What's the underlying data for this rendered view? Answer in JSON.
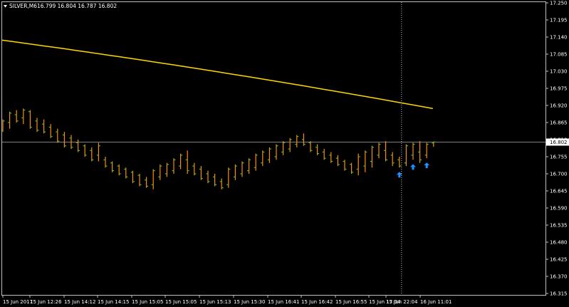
{
  "header": {
    "menu_icon": "triangle-down-icon",
    "title": "SILVER,M6",
    "ohlc": "16.799 16.804 16.787 16.802"
  },
  "colors": {
    "background": "#000000",
    "axis": "#c0c0c0",
    "bar_up": "#32cd32",
    "bar_down": "#ff8c00",
    "moving_average": "#ffd700",
    "bid_line": "#808080",
    "crosshair": "#c0c0c0",
    "arrow": "#1e90ff",
    "price_box": "#ffffff"
  },
  "price_axis": {
    "labels": [
      "17.250",
      "17.195",
      "17.140",
      "17.085",
      "17.030",
      "16.975",
      "16.920",
      "16.865",
      "16.810",
      "16.755",
      "16.700",
      "16.645",
      "16.590",
      "16.535",
      "16.480",
      "16.425",
      "16.370",
      "16.315"
    ],
    "current_price": "16.802"
  },
  "time_axis": {
    "labels": [
      "15 Jun 2017",
      "15 Jun 12:26",
      "15 Jun 14:12",
      "15 Jun 14:15",
      "15 Jun 15:05",
      "15 Jun 15:05",
      "15 Jun 15:13",
      "15 Jun 15:30",
      "15 Jun 16:41",
      "15 Jun 16:42",
      "15 Jun 16:55",
      "15 Jun 17:04",
      "15 Jun 22:04",
      "16 Jun 11:01"
    ]
  },
  "chart_data": {
    "type": "ohlc_bar",
    "symbol": "SILVER",
    "timeframe": "M6",
    "ylim": [
      16.31,
      17.25
    ],
    "bars": [
      {
        "o": 16.84,
        "h": 16.875,
        "l": 16.835,
        "c": 16.87
      },
      {
        "o": 16.865,
        "h": 16.9,
        "l": 16.845,
        "c": 16.895
      },
      {
        "o": 16.89,
        "h": 16.905,
        "l": 16.865,
        "c": 16.87
      },
      {
        "o": 16.88,
        "h": 16.91,
        "l": 16.86,
        "c": 16.905
      },
      {
        "o": 16.9,
        "h": 16.905,
        "l": 16.845,
        "c": 16.85
      },
      {
        "o": 16.87,
        "h": 16.88,
        "l": 16.835,
        "c": 16.84
      },
      {
        "o": 16.86,
        "h": 16.875,
        "l": 16.83,
        "c": 16.835
      },
      {
        "o": 16.85,
        "h": 16.86,
        "l": 16.815,
        "c": 16.82
      },
      {
        "o": 16.835,
        "h": 16.845,
        "l": 16.8,
        "c": 16.805
      },
      {
        "o": 16.825,
        "h": 16.835,
        "l": 16.785,
        "c": 16.79
      },
      {
        "o": 16.815,
        "h": 16.825,
        "l": 16.78,
        "c": 16.785
      },
      {
        "o": 16.8,
        "h": 16.81,
        "l": 16.77,
        "c": 16.775
      },
      {
        "o": 16.79,
        "h": 16.795,
        "l": 16.755,
        "c": 16.76
      },
      {
        "o": 16.775,
        "h": 16.785,
        "l": 16.74,
        "c": 16.745
      },
      {
        "o": 16.76,
        "h": 16.8,
        "l": 16.74,
        "c": 16.79
      },
      {
        "o": 16.745,
        "h": 16.755,
        "l": 16.72,
        "c": 16.725
      },
      {
        "o": 16.735,
        "h": 16.74,
        "l": 16.705,
        "c": 16.71
      },
      {
        "o": 16.725,
        "h": 16.73,
        "l": 16.695,
        "c": 16.7
      },
      {
        "o": 16.715,
        "h": 16.72,
        "l": 16.685,
        "c": 16.69
      },
      {
        "o": 16.705,
        "h": 16.71,
        "l": 16.67,
        "c": 16.675
      },
      {
        "o": 16.695,
        "h": 16.7,
        "l": 16.66,
        "c": 16.665
      },
      {
        "o": 16.68,
        "h": 16.69,
        "l": 16.655,
        "c": 16.66
      },
      {
        "o": 16.665,
        "h": 16.715,
        "l": 16.65,
        "c": 16.71
      },
      {
        "o": 16.69,
        "h": 16.73,
        "l": 16.68,
        "c": 16.725
      },
      {
        "o": 16.7,
        "h": 16.735,
        "l": 16.69,
        "c": 16.73
      },
      {
        "o": 16.71,
        "h": 16.75,
        "l": 16.7,
        "c": 16.745
      },
      {
        "o": 16.725,
        "h": 16.765,
        "l": 16.715,
        "c": 16.76
      },
      {
        "o": 16.745,
        "h": 16.775,
        "l": 16.7,
        "c": 16.71
      },
      {
        "o": 16.725,
        "h": 16.735,
        "l": 16.695,
        "c": 16.7
      },
      {
        "o": 16.715,
        "h": 16.725,
        "l": 16.68,
        "c": 16.685
      },
      {
        "o": 16.7,
        "h": 16.71,
        "l": 16.67,
        "c": 16.675
      },
      {
        "o": 16.69,
        "h": 16.7,
        "l": 16.66,
        "c": 16.665
      },
      {
        "o": 16.675,
        "h": 16.685,
        "l": 16.65,
        "c": 16.655
      },
      {
        "o": 16.665,
        "h": 16.72,
        "l": 16.655,
        "c": 16.715
      },
      {
        "o": 16.69,
        "h": 16.73,
        "l": 16.68,
        "c": 16.725
      },
      {
        "o": 16.7,
        "h": 16.74,
        "l": 16.69,
        "c": 16.735
      },
      {
        "o": 16.71,
        "h": 16.75,
        "l": 16.7,
        "c": 16.745
      },
      {
        "o": 16.72,
        "h": 16.765,
        "l": 16.71,
        "c": 16.76
      },
      {
        "o": 16.735,
        "h": 16.775,
        "l": 16.725,
        "c": 16.77
      },
      {
        "o": 16.745,
        "h": 16.785,
        "l": 16.735,
        "c": 16.78
      },
      {
        "o": 16.755,
        "h": 16.795,
        "l": 16.745,
        "c": 16.79
      },
      {
        "o": 16.77,
        "h": 16.805,
        "l": 16.76,
        "c": 16.8
      },
      {
        "o": 16.78,
        "h": 16.815,
        "l": 16.77,
        "c": 16.81
      },
      {
        "o": 16.795,
        "h": 16.825,
        "l": 16.785,
        "c": 16.82
      },
      {
        "o": 16.81,
        "h": 16.83,
        "l": 16.79,
        "c": 16.795
      },
      {
        "o": 16.8,
        "h": 16.805,
        "l": 16.77,
        "c": 16.775
      },
      {
        "o": 16.785,
        "h": 16.795,
        "l": 16.76,
        "c": 16.765
      },
      {
        "o": 16.77,
        "h": 16.78,
        "l": 16.745,
        "c": 16.75
      },
      {
        "o": 16.76,
        "h": 16.77,
        "l": 16.735,
        "c": 16.74
      },
      {
        "o": 16.75,
        "h": 16.76,
        "l": 16.725,
        "c": 16.73
      },
      {
        "o": 16.74,
        "h": 16.745,
        "l": 16.71,
        "c": 16.715
      },
      {
        "o": 16.73,
        "h": 16.735,
        "l": 16.7,
        "c": 16.705
      },
      {
        "o": 16.715,
        "h": 16.765,
        "l": 16.695,
        "c": 16.755
      },
      {
        "o": 16.725,
        "h": 16.775,
        "l": 16.705,
        "c": 16.77
      },
      {
        "o": 16.74,
        "h": 16.79,
        "l": 16.72,
        "c": 16.785
      },
      {
        "o": 16.76,
        "h": 16.8,
        "l": 16.75,
        "c": 16.795
      },
      {
        "o": 16.775,
        "h": 16.805,
        "l": 16.74,
        "c": 16.745
      },
      {
        "o": 16.76,
        "h": 16.77,
        "l": 16.725,
        "c": 16.735
      },
      {
        "o": 16.745,
        "h": 16.755,
        "l": 16.72,
        "c": 16.725
      },
      {
        "o": 16.735,
        "h": 16.795,
        "l": 16.725,
        "c": 16.79
      },
      {
        "o": 16.76,
        "h": 16.8,
        "l": 16.745,
        "c": 16.795
      },
      {
        "o": 16.77,
        "h": 16.805,
        "l": 16.735,
        "c": 16.745
      },
      {
        "o": 16.76,
        "h": 16.8,
        "l": 16.75,
        "c": 16.795
      },
      {
        "o": 16.799,
        "h": 16.804,
        "l": 16.787,
        "c": 16.802
      }
    ],
    "moving_average": {
      "start": 17.13,
      "end": 16.91
    },
    "arrows_at_bar": [
      58,
      60,
      62
    ],
    "crosshair_bar": 58
  }
}
